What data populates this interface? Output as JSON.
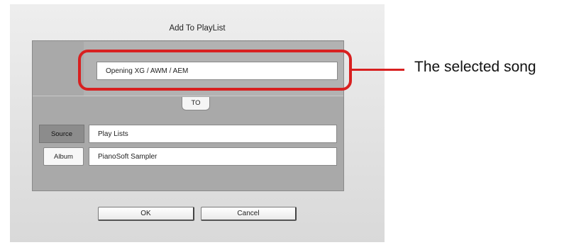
{
  "dialog": {
    "title": "Add To PlayList",
    "song": {
      "value": "Opening XG / AWM / AEM"
    },
    "to_label": "TO",
    "rows": [
      {
        "label": "Source",
        "value": "Play Lists"
      },
      {
        "label": "Album",
        "value": "PianoSoft Sampler"
      }
    ],
    "buttons": {
      "ok": "OK",
      "cancel": "Cancel"
    }
  },
  "annotation": {
    "text": "The selected song",
    "color": "#d82020"
  }
}
